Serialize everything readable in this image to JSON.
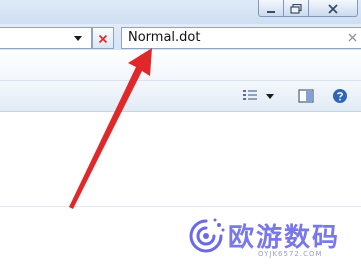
{
  "search": {
    "query": "Normal.dot"
  },
  "address_bar": {
    "value": ""
  },
  "icons": {
    "minimize": "minimize-icon",
    "maximize": "maximize-icon",
    "close": "close-icon",
    "dropdown": "chevron-down-icon",
    "stop": "stop-icon",
    "search_clear": "clear-icon",
    "views": "view-options-icon",
    "views_menu": "chevron-down-icon",
    "preview_pane": "preview-pane-icon",
    "help": "help-icon"
  },
  "colors": {
    "stop_x": "#d9312a",
    "annotation_arrow": "#e0282a",
    "watermark": "#6a6ae8"
  },
  "watermark": {
    "title": "欧游数码",
    "url": "OYJK6572.COM"
  }
}
